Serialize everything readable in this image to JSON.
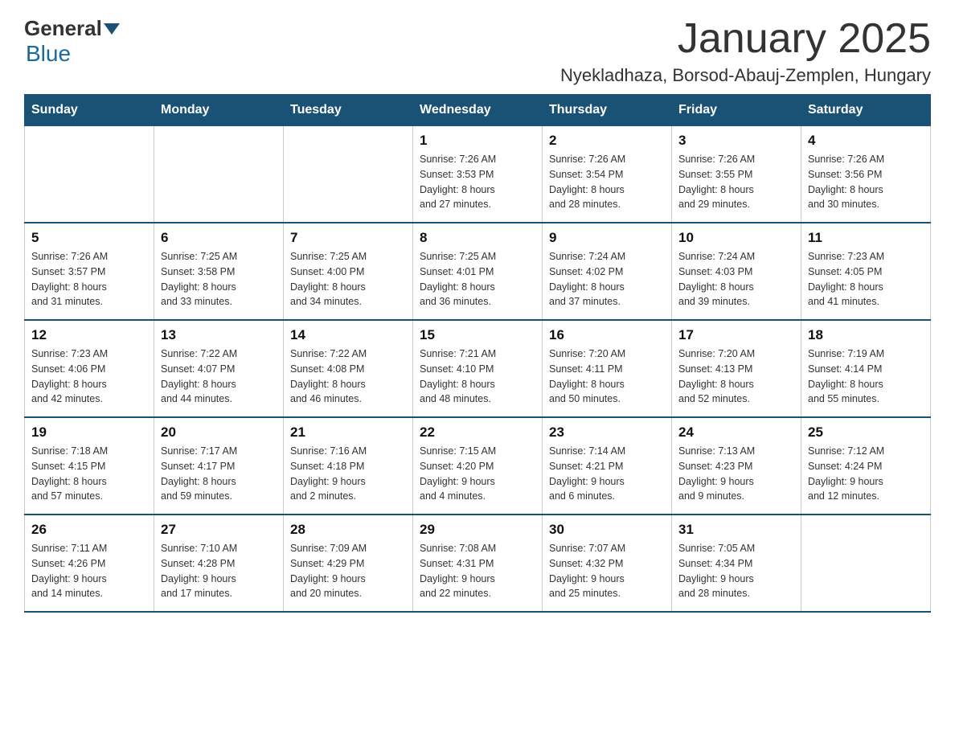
{
  "logo": {
    "general": "General",
    "blue": "Blue"
  },
  "title": "January 2025",
  "location": "Nyekladhaza, Borsod-Abauj-Zemplen, Hungary",
  "weekdays": [
    "Sunday",
    "Monday",
    "Tuesday",
    "Wednesday",
    "Thursday",
    "Friday",
    "Saturday"
  ],
  "weeks": [
    [
      {
        "day": "",
        "info": ""
      },
      {
        "day": "",
        "info": ""
      },
      {
        "day": "",
        "info": ""
      },
      {
        "day": "1",
        "info": "Sunrise: 7:26 AM\nSunset: 3:53 PM\nDaylight: 8 hours\nand 27 minutes."
      },
      {
        "day": "2",
        "info": "Sunrise: 7:26 AM\nSunset: 3:54 PM\nDaylight: 8 hours\nand 28 minutes."
      },
      {
        "day": "3",
        "info": "Sunrise: 7:26 AM\nSunset: 3:55 PM\nDaylight: 8 hours\nand 29 minutes."
      },
      {
        "day": "4",
        "info": "Sunrise: 7:26 AM\nSunset: 3:56 PM\nDaylight: 8 hours\nand 30 minutes."
      }
    ],
    [
      {
        "day": "5",
        "info": "Sunrise: 7:26 AM\nSunset: 3:57 PM\nDaylight: 8 hours\nand 31 minutes."
      },
      {
        "day": "6",
        "info": "Sunrise: 7:25 AM\nSunset: 3:58 PM\nDaylight: 8 hours\nand 33 minutes."
      },
      {
        "day": "7",
        "info": "Sunrise: 7:25 AM\nSunset: 4:00 PM\nDaylight: 8 hours\nand 34 minutes."
      },
      {
        "day": "8",
        "info": "Sunrise: 7:25 AM\nSunset: 4:01 PM\nDaylight: 8 hours\nand 36 minutes."
      },
      {
        "day": "9",
        "info": "Sunrise: 7:24 AM\nSunset: 4:02 PM\nDaylight: 8 hours\nand 37 minutes."
      },
      {
        "day": "10",
        "info": "Sunrise: 7:24 AM\nSunset: 4:03 PM\nDaylight: 8 hours\nand 39 minutes."
      },
      {
        "day": "11",
        "info": "Sunrise: 7:23 AM\nSunset: 4:05 PM\nDaylight: 8 hours\nand 41 minutes."
      }
    ],
    [
      {
        "day": "12",
        "info": "Sunrise: 7:23 AM\nSunset: 4:06 PM\nDaylight: 8 hours\nand 42 minutes."
      },
      {
        "day": "13",
        "info": "Sunrise: 7:22 AM\nSunset: 4:07 PM\nDaylight: 8 hours\nand 44 minutes."
      },
      {
        "day": "14",
        "info": "Sunrise: 7:22 AM\nSunset: 4:08 PM\nDaylight: 8 hours\nand 46 minutes."
      },
      {
        "day": "15",
        "info": "Sunrise: 7:21 AM\nSunset: 4:10 PM\nDaylight: 8 hours\nand 48 minutes."
      },
      {
        "day": "16",
        "info": "Sunrise: 7:20 AM\nSunset: 4:11 PM\nDaylight: 8 hours\nand 50 minutes."
      },
      {
        "day": "17",
        "info": "Sunrise: 7:20 AM\nSunset: 4:13 PM\nDaylight: 8 hours\nand 52 minutes."
      },
      {
        "day": "18",
        "info": "Sunrise: 7:19 AM\nSunset: 4:14 PM\nDaylight: 8 hours\nand 55 minutes."
      }
    ],
    [
      {
        "day": "19",
        "info": "Sunrise: 7:18 AM\nSunset: 4:15 PM\nDaylight: 8 hours\nand 57 minutes."
      },
      {
        "day": "20",
        "info": "Sunrise: 7:17 AM\nSunset: 4:17 PM\nDaylight: 8 hours\nand 59 minutes."
      },
      {
        "day": "21",
        "info": "Sunrise: 7:16 AM\nSunset: 4:18 PM\nDaylight: 9 hours\nand 2 minutes."
      },
      {
        "day": "22",
        "info": "Sunrise: 7:15 AM\nSunset: 4:20 PM\nDaylight: 9 hours\nand 4 minutes."
      },
      {
        "day": "23",
        "info": "Sunrise: 7:14 AM\nSunset: 4:21 PM\nDaylight: 9 hours\nand 6 minutes."
      },
      {
        "day": "24",
        "info": "Sunrise: 7:13 AM\nSunset: 4:23 PM\nDaylight: 9 hours\nand 9 minutes."
      },
      {
        "day": "25",
        "info": "Sunrise: 7:12 AM\nSunset: 4:24 PM\nDaylight: 9 hours\nand 12 minutes."
      }
    ],
    [
      {
        "day": "26",
        "info": "Sunrise: 7:11 AM\nSunset: 4:26 PM\nDaylight: 9 hours\nand 14 minutes."
      },
      {
        "day": "27",
        "info": "Sunrise: 7:10 AM\nSunset: 4:28 PM\nDaylight: 9 hours\nand 17 minutes."
      },
      {
        "day": "28",
        "info": "Sunrise: 7:09 AM\nSunset: 4:29 PM\nDaylight: 9 hours\nand 20 minutes."
      },
      {
        "day": "29",
        "info": "Sunrise: 7:08 AM\nSunset: 4:31 PM\nDaylight: 9 hours\nand 22 minutes."
      },
      {
        "day": "30",
        "info": "Sunrise: 7:07 AM\nSunset: 4:32 PM\nDaylight: 9 hours\nand 25 minutes."
      },
      {
        "day": "31",
        "info": "Sunrise: 7:05 AM\nSunset: 4:34 PM\nDaylight: 9 hours\nand 28 minutes."
      },
      {
        "day": "",
        "info": ""
      }
    ]
  ]
}
